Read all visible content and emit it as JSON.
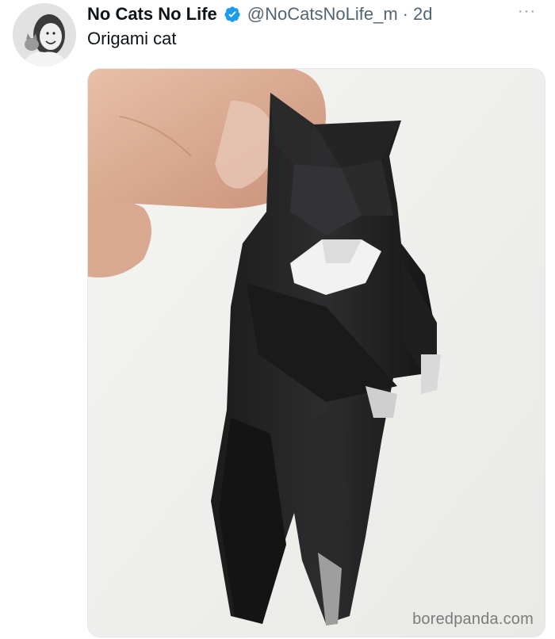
{
  "tweet": {
    "display_name": "No Cats No Life",
    "verified_icon": "verified-badge-icon",
    "handle": "@NoCatsNoLife_m",
    "separator": "·",
    "time": "2d",
    "more_label": "···",
    "text": "Origami cat"
  },
  "media": {
    "content": "photo of a black-and-white origami cat held between fingers"
  },
  "watermark": "boredpanda.com",
  "colors": {
    "verified_blue": "#1d9bf0",
    "text_primary": "#0f1419",
    "text_secondary": "#536471"
  }
}
